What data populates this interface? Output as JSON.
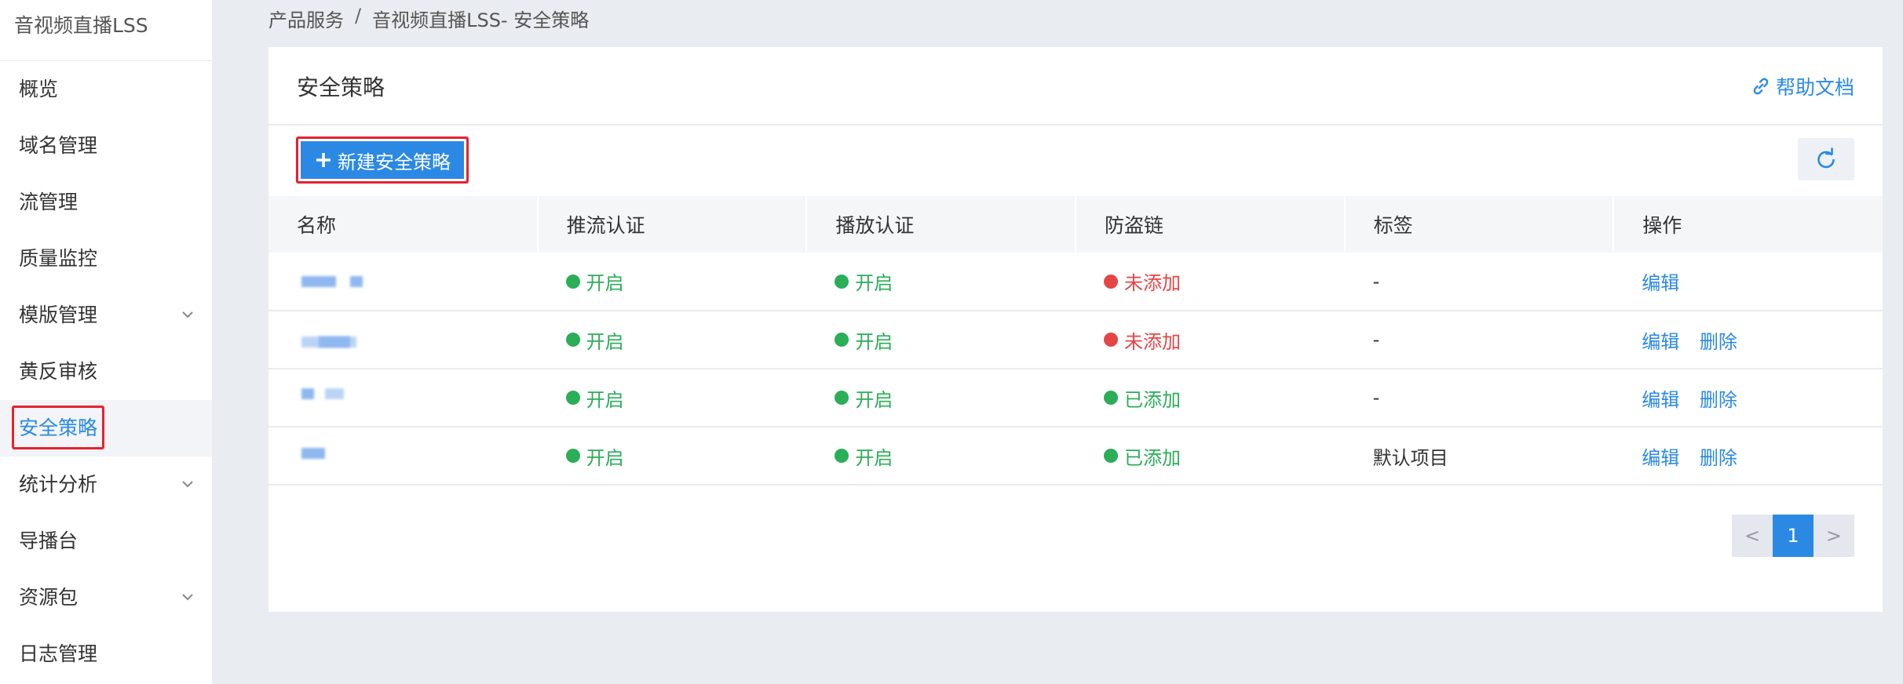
{
  "sidebar": {
    "title": "音视频直播LSS",
    "items": [
      {
        "label": "概览"
      },
      {
        "label": "域名管理"
      },
      {
        "label": "流管理"
      },
      {
        "label": "质量监控"
      },
      {
        "label": "模版管理"
      },
      {
        "label": "黄反审核"
      },
      {
        "label": "安全策略"
      },
      {
        "label": "统计分析"
      },
      {
        "label": "导播台"
      },
      {
        "label": "资源包"
      },
      {
        "label": "日志管理"
      }
    ]
  },
  "breadcrumb": {
    "parent": "产品服务",
    "separator": "/",
    "current": "音视频直播LSS- 安全策略"
  },
  "card": {
    "title": "安全策略",
    "help_label": "帮助文档",
    "new_button_label": "新建安全策略"
  },
  "table": {
    "columns": [
      "名称",
      "推流认证",
      "播放认证",
      "防盗链",
      "标签",
      "操作"
    ],
    "rows": [
      {
        "push_auth": "开启",
        "play_auth": "开启",
        "hotlink": "未添加",
        "tag": "-",
        "edit": "编辑",
        "delete": ""
      },
      {
        "push_auth": "开启",
        "play_auth": "开启",
        "hotlink": "未添加",
        "tag": "-",
        "edit": "编辑",
        "delete": "删除"
      },
      {
        "push_auth": "开启",
        "play_auth": "开启",
        "hotlink": "已添加",
        "tag": "-",
        "edit": "编辑",
        "delete": "删除"
      },
      {
        "push_auth": "开启",
        "play_auth": "开启",
        "hotlink": "已添加",
        "tag": "默认项目",
        "edit": "编辑",
        "delete": "删除"
      }
    ]
  },
  "pagination": {
    "prev": "<",
    "current": "1",
    "next": ">"
  },
  "colors": {
    "accent": "#2b89e4",
    "success": "#2aae58",
    "danger": "#e64545",
    "highlight_border": "#e8212e"
  }
}
